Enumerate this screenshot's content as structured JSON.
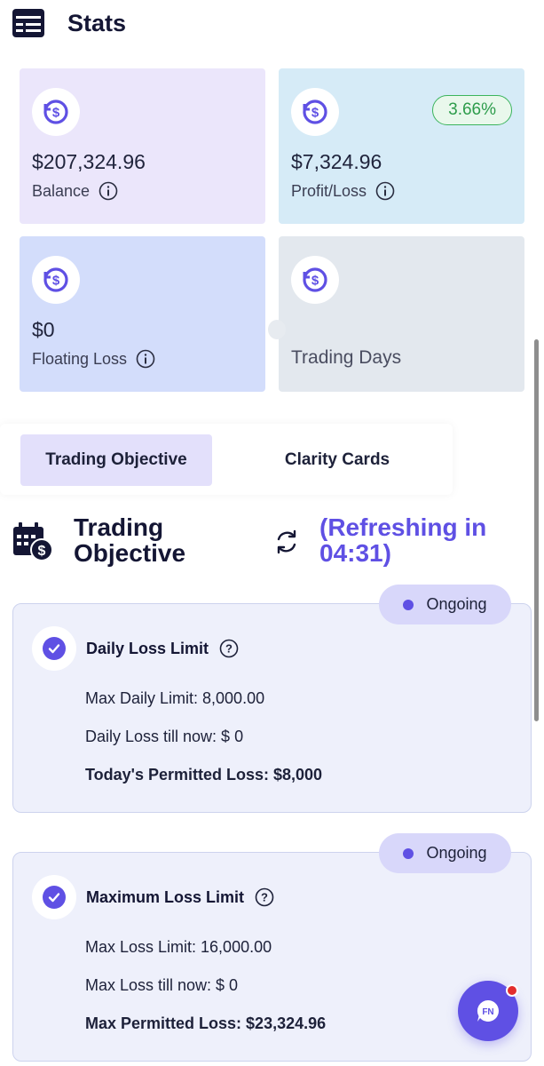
{
  "header": {
    "title": "Stats",
    "icon": "stats-icon"
  },
  "stats": {
    "balance": {
      "value": "$207,324.96",
      "label": "Balance"
    },
    "profit": {
      "value": "$7,324.96",
      "label": "Profit/Loss",
      "badge": "3.66%"
    },
    "floating": {
      "value": "$0",
      "label": "Floating Loss"
    },
    "days": {
      "label": "Trading Days"
    }
  },
  "tabs": [
    {
      "label": "Trading Objective",
      "active": true
    },
    {
      "label": "Clarity Cards",
      "active": false
    }
  ],
  "objective_section": {
    "title_line1": "Trading",
    "title_line2": "Objective",
    "refresh_line1": "(Refreshing in",
    "refresh_line2": "04:31)"
  },
  "objectives": [
    {
      "status": "Ongoing",
      "title": "Daily Loss Limit",
      "lines": [
        "Max Daily Limit: 8,000.00",
        "Daily Loss till now: $ 0",
        "Today's Permitted Loss: $8,000"
      ]
    },
    {
      "status": "Ongoing",
      "title": "Maximum Loss Limit",
      "lines": [
        "Max Loss Limit: 16,000.00",
        "Max Loss till now: $ 0",
        "Max Permitted Loss: $23,324.96"
      ]
    }
  ],
  "chat_button": {
    "icon": "chat-bubble-icon",
    "badge_color": "#e32d2d"
  },
  "colors": {
    "accent": "#5f50e4",
    "positive": "#2d9c4b",
    "header_text": "#141634"
  }
}
